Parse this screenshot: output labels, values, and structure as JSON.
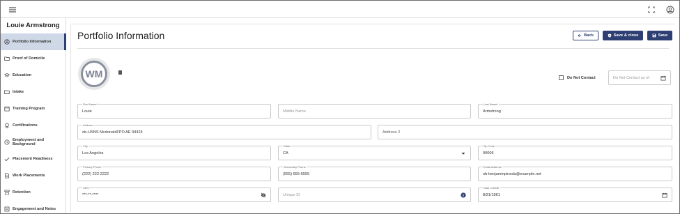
{
  "topbar": {
    "menu_icon": "hamburger-icon",
    "fullscreen_icon": "expand-icon",
    "account_icon": "account-circle-icon"
  },
  "sidebar": {
    "name": "Louie Armstrong",
    "items": [
      {
        "label": "Portfolio Information",
        "icon": "account-circle-icon"
      },
      {
        "label": "Proof of Domicile",
        "icon": "folder-icon"
      },
      {
        "label": "Education",
        "icon": "graduation-cap-icon"
      },
      {
        "label": "Intake",
        "icon": "folder-icon"
      },
      {
        "label": "Training Program",
        "icon": "calendar-icon"
      },
      {
        "label": "Certifications",
        "icon": "certificate-icon"
      },
      {
        "label": "Employment and Background",
        "icon": "clock-icon"
      },
      {
        "label": "Placement Readiness",
        "icon": "check-icon"
      },
      {
        "label": "Work Placements",
        "icon": "document-icon"
      },
      {
        "label": "Retention",
        "icon": "archive-icon"
      },
      {
        "label": "Engagement and Notes",
        "icon": "notes-icon"
      }
    ]
  },
  "main": {
    "title": "Portfolio Information",
    "buttons": {
      "back": "Back",
      "save_close": "Save & close",
      "save": "Save"
    },
    "avatar_initials": "WM",
    "do_not_contact_label": "Do Not Contact",
    "do_not_contact_as_of_placeholder": "Do Not Contact as of"
  },
  "form": {
    "first_name": {
      "label": "First Name*",
      "value": "Louie"
    },
    "middle_name": {
      "placeholder": "Middle Name"
    },
    "last_name": {
      "label": "Last Name*",
      "value": "Armstrong"
    },
    "address": {
      "label": "Address",
      "value": "ob-USNS McdonaldFPO AE 94424"
    },
    "address2": {
      "placeholder": "Address 2"
    },
    "city": {
      "label": "City",
      "value": "Los Angeles"
    },
    "state": {
      "label": "State",
      "value": "CA"
    },
    "zip": {
      "label": "Zip Code",
      "value": "90006"
    },
    "primary_phone": {
      "label": "Primary Phone",
      "value": "(222) 222-2222"
    },
    "secondary_phone": {
      "label": "Secondary Phone",
      "value": "(555) 555-5555"
    },
    "email": {
      "label": "Email Address",
      "value": "ob-benjaminpineda@example.net"
    },
    "ssn": {
      "label": "SSN",
      "value": "***-**-****"
    },
    "unique_id": {
      "placeholder": "Unique ID"
    },
    "dob": {
      "label": "Date of Birth",
      "value": "8/21/1961"
    }
  }
}
